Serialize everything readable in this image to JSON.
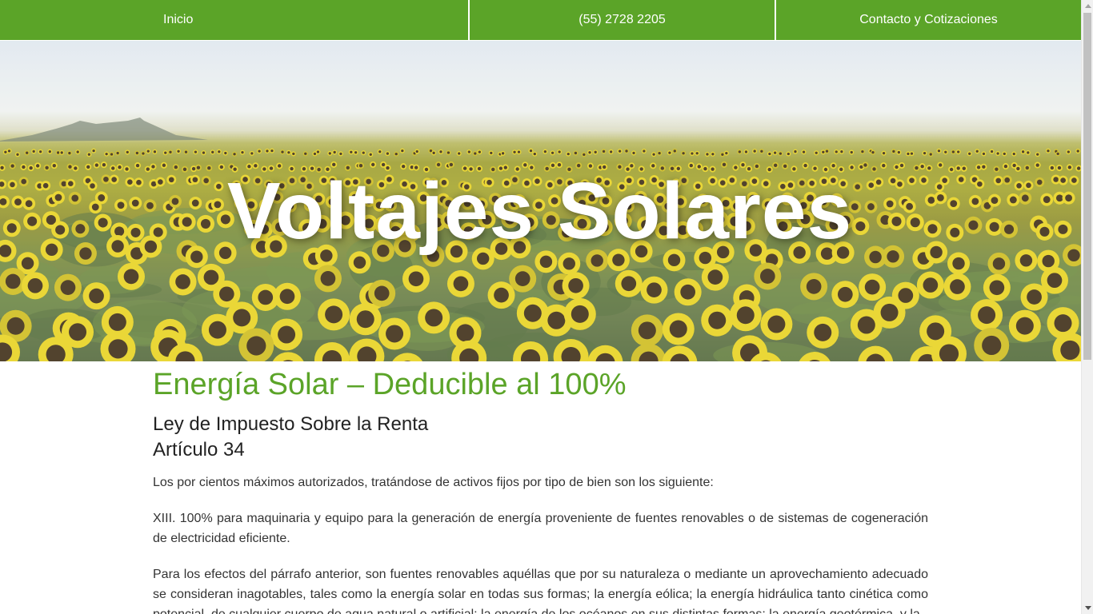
{
  "nav": {
    "items": [
      {
        "label": "Inicio"
      },
      {
        "label": "(55) 2728 2205"
      },
      {
        "label": "Contacto y Cotizaciones"
      }
    ]
  },
  "hero": {
    "title": "Voltajes Solares"
  },
  "content": {
    "heading": "Energía Solar – Deducible al 100%",
    "subheading_line1": "Ley de Impuesto Sobre la Renta",
    "subheading_line2": "Artículo 34",
    "paragraphs": [
      "Los por cientos máximos autorizados, tratándose de activos fijos por tipo de bien son los siguiente:",
      "XIII. 100% para maquinaria y equipo para la generación de energía proveniente de fuentes renovables o de sistemas de cogeneración de electricidad eficiente.",
      "Para los efectos del párrafo anterior, son fuentes renovables aquéllas que por su naturaleza o mediante un aprovechamiento adecuado se consideran inagotables, tales como la energía solar en todas sus formas; la energía eólica; la energía hidráulica tanto cinética como potencial, de cualquier cuerpo de agua natural o artificial; la energía de los océanos en sus distintas formas; la energía geotérmica, y la"
    ]
  },
  "colors": {
    "accent_green": "#5ba428",
    "nav_text": "#ffffff",
    "body_text": "#333333"
  },
  "scrollbar": {
    "position_fraction": 0.0
  }
}
